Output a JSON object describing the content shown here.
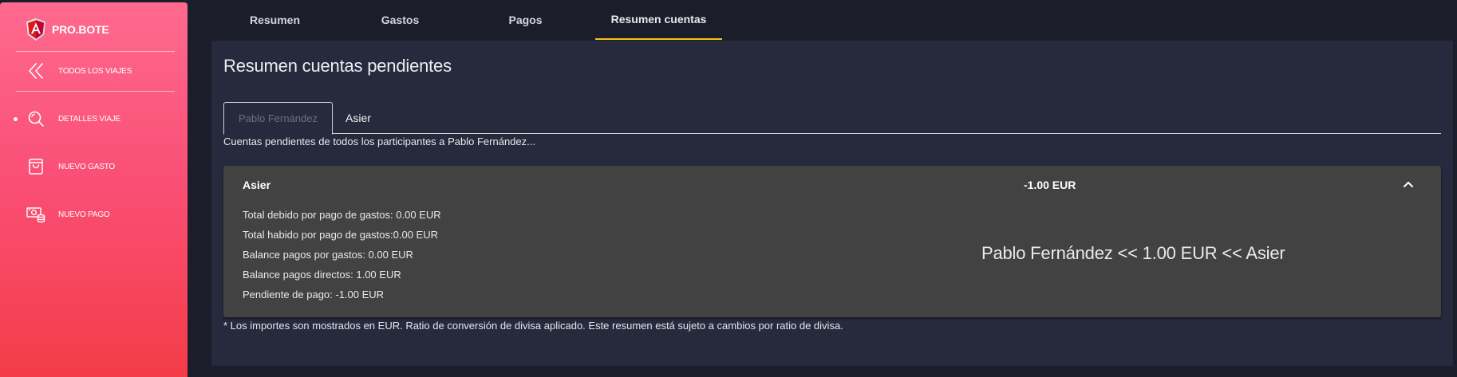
{
  "app": {
    "brand": "PRO.BOTE"
  },
  "sidebar": {
    "items": [
      {
        "label": "TODOS LOS VIAJES",
        "icon": "chevrons-left-icon"
      },
      {
        "label": "DETALLES VIAJE",
        "icon": "search-icon"
      },
      {
        "label": "NUEVO GASTO",
        "icon": "shopping-bag-icon"
      },
      {
        "label": "NUEVO PAGO",
        "icon": "cash-icon"
      }
    ],
    "active_index": 1
  },
  "top_tabs": {
    "items": [
      {
        "label": "Resumen"
      },
      {
        "label": "Gastos"
      },
      {
        "label": "Pagos"
      },
      {
        "label": "Resumen cuentas"
      }
    ],
    "active_index": 3,
    "accent_color": "#f5c518"
  },
  "main": {
    "title": "Resumen cuentas pendientes",
    "person_tabs": [
      {
        "label": "Pablo Fernández"
      },
      {
        "label": "Asier"
      }
    ],
    "active_person_index": 0,
    "description": "Cuentas pendientes de todos los participantes a Pablo Fernández...",
    "card": {
      "name": "Asier",
      "amount": "-1.00 EUR",
      "lines": [
        "Total debido por pago de gastos: 0.00 EUR",
        "Total habido por pago de gastos:0.00 EUR",
        "Balance pagos por gastos: 0.00 EUR",
        "Balance pagos directos: 1.00 EUR",
        "Pendiente de pago: -1.00 EUR"
      ],
      "summary": "Pablo Fernández << 1.00 EUR << Asier"
    },
    "footnote": "* Los importes son mostrados en EUR. Ratio de conversión de divisa aplicado. Este resumen está sujeto a cambios por ratio de divisa."
  },
  "colors": {
    "sidebar_top": "#ff6a8e",
    "sidebar_bottom": "#f43c48",
    "background": "#1c1d2b",
    "panel": "#272a3d",
    "card": "#424242"
  }
}
